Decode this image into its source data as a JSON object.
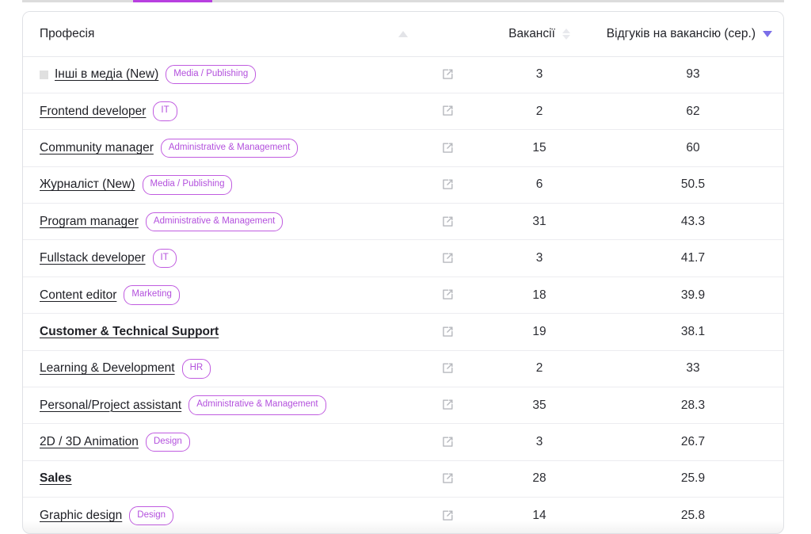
{
  "tabstrip": {
    "active_tab_indicator": "active"
  },
  "table": {
    "columns": [
      {
        "key": "profession",
        "label": "Професія",
        "sort_state": "ascending-inactive",
        "sort_icon": "triangle-up-icon"
      },
      {
        "key": "link",
        "label": "",
        "sort_state": "none",
        "sort_icon": ""
      },
      {
        "key": "vacancies",
        "label": "Вакансії",
        "sort_state": "unsorted",
        "sort_icon": "sort-updown-icon"
      },
      {
        "key": "responses",
        "label": "Відгуків на вакансію (сер.)",
        "sort_state": "descending-active",
        "sort_icon": "triangle-down-icon"
      }
    ],
    "link_icon_name": "external-link-icon",
    "rows": [
      {
        "profession": "Інші в медіа (New)",
        "has_marker": true,
        "bold": false,
        "tag": "Media / Publishing",
        "vacancies": "3",
        "responses": "93"
      },
      {
        "profession": "Frontend developer",
        "has_marker": false,
        "bold": false,
        "tag": "IT",
        "vacancies": "2",
        "responses": "62"
      },
      {
        "profession": "Community manager",
        "has_marker": false,
        "bold": false,
        "tag": "Administrative & Management",
        "vacancies": "15",
        "responses": "60"
      },
      {
        "profession": "Журналіст (New)",
        "has_marker": false,
        "bold": false,
        "tag": "Media / Publishing",
        "vacancies": "6",
        "responses": "50.5"
      },
      {
        "profession": "Program manager",
        "has_marker": false,
        "bold": false,
        "tag": "Administrative & Management",
        "vacancies": "31",
        "responses": "43.3"
      },
      {
        "profession": "Fullstack developer",
        "has_marker": false,
        "bold": false,
        "tag": "IT",
        "vacancies": "3",
        "responses": "41.7"
      },
      {
        "profession": "Content editor",
        "has_marker": false,
        "bold": false,
        "tag": "Marketing",
        "vacancies": "18",
        "responses": "39.9"
      },
      {
        "profession": "Customer & Technical Support",
        "has_marker": false,
        "bold": true,
        "tag": "",
        "vacancies": "19",
        "responses": "38.1"
      },
      {
        "profession": "Learning & Development",
        "has_marker": false,
        "bold": false,
        "tag": "HR",
        "vacancies": "2",
        "responses": "33"
      },
      {
        "profession": "Personal/Project assistant",
        "has_marker": false,
        "bold": false,
        "tag": "Administrative & Management",
        "vacancies": "35",
        "responses": "28.3"
      },
      {
        "profession": "2D / 3D Animation",
        "has_marker": false,
        "bold": false,
        "tag": "Design",
        "vacancies": "3",
        "responses": "26.7"
      },
      {
        "profession": "Sales",
        "has_marker": false,
        "bold": true,
        "tag": "",
        "vacancies": "28",
        "responses": "25.9"
      },
      {
        "profession": "Graphic design",
        "has_marker": false,
        "bold": false,
        "tag": "Design",
        "vacancies": "14",
        "responses": "25.8"
      }
    ]
  },
  "colors": {
    "tag_border": "#c05ce0",
    "tag_text": "#b350dd",
    "active_sort": "#7b6ee8",
    "tab_active": "#b83fe0"
  }
}
